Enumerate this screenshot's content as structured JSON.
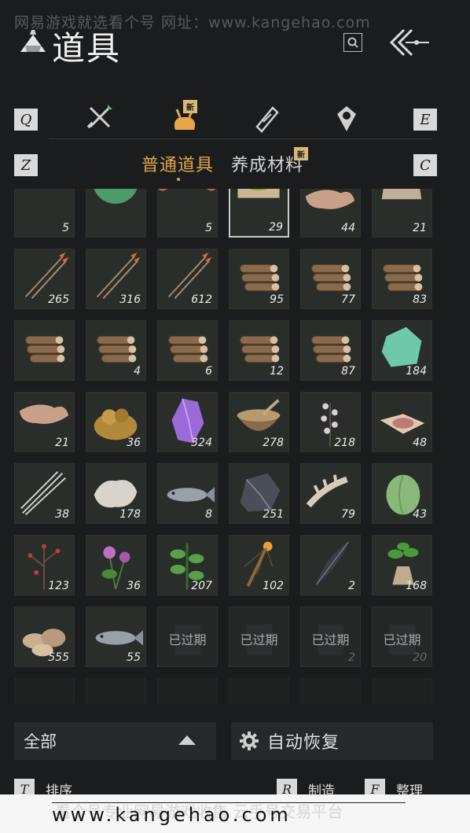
{
  "watermark": {
    "top": "网易游戏就选看个号   网址：www.kangehao.com",
    "bottom_faded": "看个号专业网易游戏收售      云手号交易平台",
    "bottom_url": "www.kangehao.com"
  },
  "header": {
    "title": "道具",
    "search_icon": "search-icon",
    "back_icon": "back-arrow-icon"
  },
  "category_tabs": {
    "left_key": "Q",
    "right_key": "E",
    "items": [
      {
        "icon": "weapons-icon",
        "new": false
      },
      {
        "icon": "pouch-icon",
        "new": true,
        "badge": "新"
      },
      {
        "icon": "scroll-icon",
        "new": false
      },
      {
        "icon": "gem-icon",
        "new": false
      }
    ]
  },
  "sub_tabs": {
    "left_key": "Z",
    "right_key": "C",
    "items": [
      {
        "label": "普通道具",
        "active": true
      },
      {
        "label": "养成材料",
        "badge": "新"
      }
    ]
  },
  "items": [
    {
      "icon": "bedroll-icon",
      "qty": "5"
    },
    {
      "icon": "green-orb-icon",
      "qty": ""
    },
    {
      "icon": "sausage-icon",
      "qty": "5"
    },
    {
      "icon": "powder-icon",
      "qty": "29",
      "selected": true
    },
    {
      "icon": "hide-icon",
      "qty": "44"
    },
    {
      "icon": "sack-icon",
      "qty": "21"
    },
    {
      "icon": "arrow-icon",
      "qty": "265"
    },
    {
      "icon": "arrow-icon",
      "qty": "316"
    },
    {
      "icon": "arrow-icon",
      "qty": "612"
    },
    {
      "icon": "logs-icon",
      "qty": "95"
    },
    {
      "icon": "logs-icon",
      "qty": "77"
    },
    {
      "icon": "logs-icon",
      "qty": "83"
    },
    {
      "icon": "logs-icon",
      "qty": ""
    },
    {
      "icon": "logs-icon",
      "qty": "4"
    },
    {
      "icon": "logs-icon",
      "qty": "6"
    },
    {
      "icon": "logs-icon",
      "qty": "12"
    },
    {
      "icon": "logs-icon",
      "qty": "87"
    },
    {
      "icon": "jade-icon",
      "qty": "184"
    },
    {
      "icon": "hide-icon",
      "qty": "21"
    },
    {
      "icon": "ore-icon",
      "qty": "36"
    },
    {
      "icon": "amethyst-icon",
      "qty": "324"
    },
    {
      "icon": "bowl-icon",
      "qty": "278"
    },
    {
      "icon": "flower-icon",
      "qty": "218"
    },
    {
      "icon": "meat-icon",
      "qty": "48"
    },
    {
      "icon": "quills-icon",
      "qty": "38"
    },
    {
      "icon": "fur-icon",
      "qty": "178"
    },
    {
      "icon": "fish-icon",
      "qty": "8"
    },
    {
      "icon": "coal-icon",
      "qty": "251"
    },
    {
      "icon": "bone-icon",
      "qty": "79"
    },
    {
      "icon": "melon-icon",
      "qty": "43"
    },
    {
      "icon": "berry-branch-icon",
      "qty": "123"
    },
    {
      "icon": "clover-icon",
      "qty": "36"
    },
    {
      "icon": "herb-icon",
      "qty": "207"
    },
    {
      "icon": "torch-icon",
      "qty": "102"
    },
    {
      "icon": "feather-icon",
      "qty": "2"
    },
    {
      "icon": "ginseng-icon",
      "qty": "168"
    },
    {
      "icon": "shells-icon",
      "qty": "555"
    },
    {
      "icon": "fish-icon",
      "qty": "55"
    },
    {
      "icon": "expired-item-icon",
      "qty": "",
      "expired": "已过期"
    },
    {
      "icon": "expired-item-icon",
      "qty": "",
      "expired": "已过期"
    },
    {
      "icon": "expired-item-icon",
      "qty": "2",
      "expired": "已过期"
    },
    {
      "icon": "expired-item-icon",
      "qty": "20",
      "expired": "已过期"
    },
    {
      "icon": "",
      "qty": "",
      "empty": true
    },
    {
      "icon": "",
      "qty": "",
      "empty": true
    },
    {
      "icon": "",
      "qty": "",
      "empty": true
    },
    {
      "icon": "",
      "qty": "",
      "empty": true
    },
    {
      "icon": "",
      "qty": "",
      "empty": true
    },
    {
      "icon": "",
      "qty": "",
      "empty": true
    }
  ],
  "controls": {
    "filter_label": "全部",
    "auto_label": "自动恢复",
    "auto_icon": "gear-icon"
  },
  "hints": [
    {
      "key": "T",
      "label": "排序"
    },
    {
      "key": "R",
      "label": "制造"
    },
    {
      "key": "F",
      "label": "整理"
    }
  ],
  "colors": {
    "accent": "#e3a64a",
    "badge": "#d9b878",
    "background": "#1b1c1d"
  }
}
